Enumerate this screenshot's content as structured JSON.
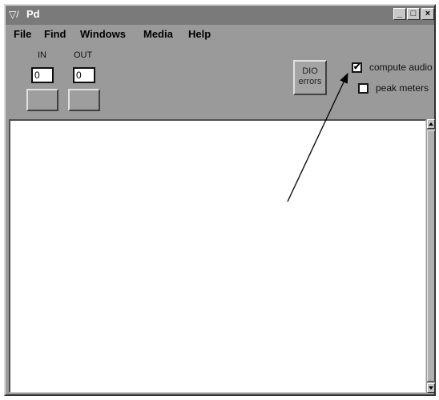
{
  "window": {
    "icon": "pd-logo-icon",
    "title": "Pd",
    "controls": {
      "minimize": "_",
      "maximize": "□",
      "close": "×"
    }
  },
  "menu": {
    "items": [
      "File",
      "Find",
      "Windows",
      "Media",
      "Help"
    ]
  },
  "io": {
    "in_label": "IN",
    "out_label": "OUT",
    "in_value": "0",
    "out_value": "0"
  },
  "dio_button": {
    "line1": "DIO",
    "line2": "errors"
  },
  "checkboxes": {
    "compute_audio": {
      "label": "compute audio",
      "checked": true,
      "mark": "✔"
    },
    "peak_meters": {
      "label": "peak meters",
      "checked": false,
      "mark": ""
    }
  },
  "colors": {
    "window_bg": "#9a9a9a",
    "titlebar_bg": "#7a7a7a",
    "console_bg": "#ffffff"
  }
}
